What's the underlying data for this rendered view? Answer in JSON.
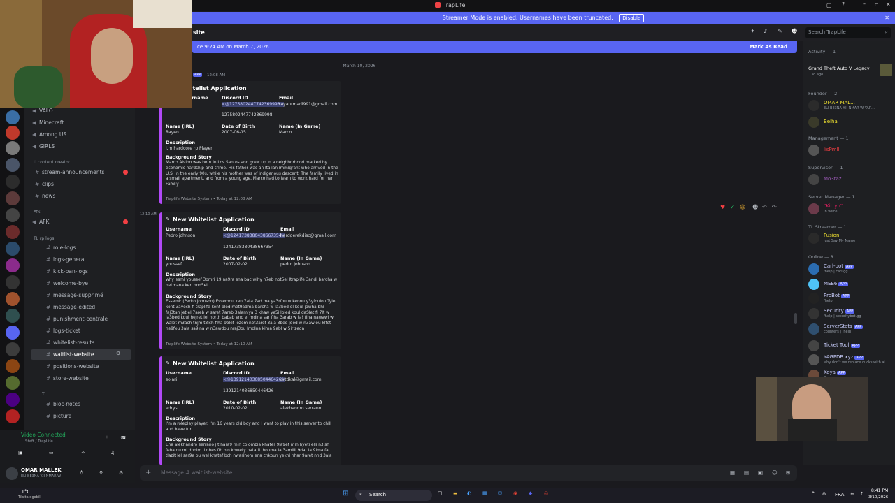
{
  "window": {
    "title": "TrapLife"
  },
  "banner": {
    "text": "Streamer Mode is enabled. Usernames have been truncated.",
    "disable": "Disable"
  },
  "header": {
    "channel": "site",
    "search_placeholder": "Search TrapLife"
  },
  "unread": {
    "text": "ce 9:24 AM on March 7, 2026",
    "mark": "Mark As Read"
  },
  "date_divider": "March 10, 2026",
  "servers": [
    "VALO",
    "Minecraft",
    "Among US",
    "GIRLS"
  ],
  "category_tl_creator": "tl content creator",
  "channels_top": [
    "stream-announcements",
    "clips",
    "news"
  ],
  "afk_category": "Afk",
  "afk_channel": "AFK",
  "logs_category": "TL rp logs",
  "channels_logs": [
    "role-logs",
    "logs-general",
    "kick-ban-logs",
    "welcome-bye",
    "message-supprimé",
    "message-edited",
    "punishment-centrale",
    "logs-ticket",
    "whitelist-results",
    "waitlist-website",
    "positions-website",
    "store-website"
  ],
  "tl_category": "TL",
  "channels_tl": [
    "bloc-notes",
    "picture"
  ],
  "voice": {
    "status": "Video Connected",
    "sub": "Staff / TrapLife"
  },
  "user": {
    "name": "OMAR MALLEK",
    "status": "ELI BE3NA Y.II NMAR W"
  },
  "msg1": {
    "badge": "APP",
    "time": "12:08 AM",
    "title": "hitelist Application",
    "username_label": "sername",
    "discordid_label": "Discord ID",
    "email_label": "Email",
    "discord_mention": "<@1275802447742369998>",
    "discord_id": "1275802447742369998",
    "email": "rayanrmadi991@gmail.com",
    "name_irl_label": "Name (IRL)",
    "name_irl": "Rayen",
    "dob_label": "Date of Birth",
    "dob": "2007-06-15",
    "name_game_label": "Name (In Game)",
    "name_game": "Marco",
    "desc_label": "Description",
    "desc": "i,m hardcore rp Player",
    "bg_label": "Background Story",
    "bg": "Marco Alvino was born in Los Santos and grew up in a neighborhood marked by economic hardship and crime. His father was an Italian immigrant who arrived in the U.S. in the early 90s, while his mother was of indigenous descent. The family lived in a small apartment, and from a young age, Marco had to learn to work hard for her Family",
    "footer": "Traplife Website System • Today at 12:08 AM"
  },
  "msg2": {
    "time": "12:10 AM",
    "title": "New Whitelist Application",
    "username_label": "Username",
    "username": "Pedro johnson",
    "discordid_label": "Discord ID",
    "discord_mention": "<@1241738380438667354>",
    "discord_id": "1241738380438667354",
    "email_label": "Email",
    "email": "hardgerekdisc@gmail.com",
    "name_irl_label": "Name (IRL)",
    "name_irl": "youssef",
    "dob_label": "Date of Birth",
    "dob": "2007-02-02",
    "name_game_label": "Name (In Game)",
    "name_game": "pedro johnson",
    "desc_label": "Description",
    "desc": "why esmi youssef 3omri 19 na9ra sna bac wihy n7eb not5el ltraplife 3andi barcha w netmana ken nod5el",
    "bg_label": "Background Story",
    "bg": "Essemi: (Pedro johnson) Essemou ken 7ata 7ad ma ya3rfou w kenou y3yfoulou Tyler kont 3ayech fi traplife kent bled met9adma barcha w la3bed el koul jawha bhi faj3tan jet el 7areb w saret 7areb 3alamiya 3 khaw ye5i lbled koul daSlet fi 7lt w la3bed koul hejret lel north babab eno el mdina sar fiha 3arab w ta! fiha nawawi w walet m3ach tnjm t3ich fiha 9olet lezem net3aref 3ala 3bed jdod w n3awlou klfet ne9fou 3ala sa9ina w n3awdou nraj3ou lmdina kima 9abl w 5ir zeda",
    "footer": "Traplife Website System • Today at 12:10 AM"
  },
  "msg3": {
    "title": "New Whitelist Application",
    "username_label": "Username",
    "username": "solari",
    "discordid_label": "Discord ID",
    "discord_mention": "<@1391214036850446426>",
    "discord_id": "1391214036850446426",
    "email_label": "Email",
    "email": "drtdkal@gmail.com",
    "name_irl_label": "Name (IRL)",
    "name_irl": "edrys",
    "dob_label": "Date of Birth",
    "dob": "2010-02-02",
    "name_game_label": "Name (In Game)",
    "name_game": "alekhandro serrano",
    "desc_label": "Description",
    "desc": "I'm a roleplay player. I'm 16 years old boy and I want to play in this server to chill and have fun .",
    "bg_label": "Background Story",
    "bg": "Ena alekhandro serrano jit hara9 min colombia khater 9la9et min hyeti elli n3ish feha ou ml dholm li nhes fih bin khwety hata fi lhouma la 3amlili 9dar la 9ima fa tlazit lel sar9a ou wel khatef bch nwarihom ena chkoun yekhi nhar 9aret nhd 3ala"
  },
  "members": {
    "activity_header": "Activity — 1",
    "activity_game": "Grand Theft Auto V Legacy",
    "activity_sub": "3d ago",
    "founder_header": "Founder — 2",
    "founder1": "OMAR MAL...",
    "founder1_sub": "ELI BE3NA Y.II NMAR W YAR...",
    "founder2": "Belha",
    "mgmt_header": "Management — 1",
    "mgmt1": "lisPmll",
    "sup_header": "Supervisor — 1",
    "sup1": "Mo3taz",
    "srv_header": "Server Manager — 1",
    "srv1": "\"Kittyn\"",
    "srv1_sub": "In voice",
    "str_header": "TL Streamer — 1",
    "str1": "Fusion",
    "str1_sub": "Just Say My Name",
    "online_header": "Online — 8",
    "bots": [
      {
        "name": "Carl-bot",
        "sub": "/help | carl.gg"
      },
      {
        "name": "MEE6",
        "sub": ""
      },
      {
        "name": "ProBot",
        "sub": "/help"
      },
      {
        "name": "Security",
        "sub": "/help | securitybot.gg"
      },
      {
        "name": "ServerStats",
        "sub": "counters | /help"
      },
      {
        "name": "Ticket Tool",
        "sub": ""
      },
      {
        "name": "YAGPDB.xyz",
        "sub": "why don't we replace ducks with ai"
      },
      {
        "name": "Koya",
        "sub": "/koya"
      }
    ],
    "bot_badge": "APP"
  },
  "composer": {
    "placeholder": "Message #  waitlist-website"
  },
  "taskbar": {
    "search": "Search",
    "weather": "11°C",
    "weather_sub": "Tilsita dgobil",
    "lang": "FRA",
    "time": "8:41 PM",
    "date": "3/10/2026"
  }
}
